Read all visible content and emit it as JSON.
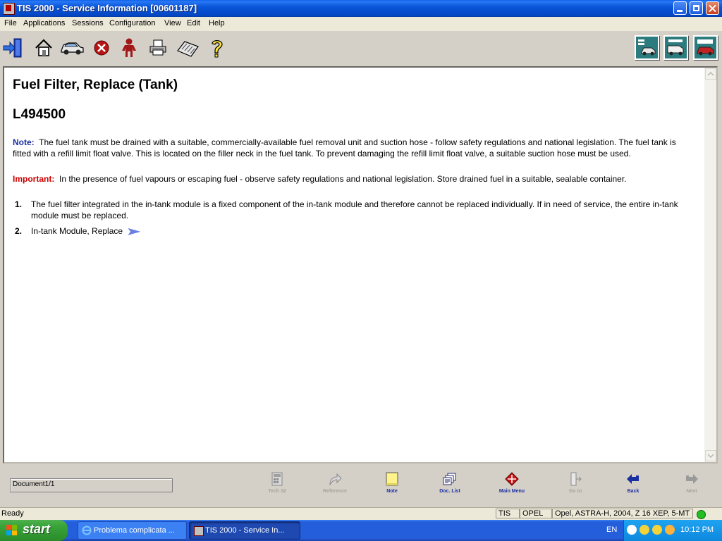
{
  "window": {
    "title": "TIS 2000 - Service Information [00601187]",
    "menus": [
      "File",
      "Applications",
      "Sessions",
      "Configuration",
      "View",
      "Edit",
      "Help"
    ]
  },
  "toolbar": {
    "icons": [
      "exit-icon",
      "home-icon",
      "vehicle-icon",
      "stop-icon",
      "user-icon",
      "print-icon",
      "keyboard-icon",
      "help-icon"
    ],
    "right_icons": [
      "vehicle-info-icon",
      "service-van-icon",
      "vehicle-catalog-icon"
    ]
  },
  "document": {
    "title": "Fuel Filter, Replace (Tank)",
    "code": "L494500",
    "note_label": "Note:",
    "note_text": "The fuel tank must be drained with a suitable, commercially-available fuel removal unit and suction hose - follow safety regulations and national legislation. The fuel tank is fitted with a refill limit float valve. This is located on the filler neck in the fuel tank. To prevent damaging the refill limit float valve, a suitable suction hose must be used.",
    "important_label": "Important:",
    "important_text": "In the presence of fuel vapours or escaping fuel - observe safety regulations and national legislation. Store drained fuel in a suitable, sealable container.",
    "steps": [
      {
        "num": "1.",
        "text": "The fuel filter integrated in the in-tank module is a fixed component of the in-tank module and therefore cannot be replaced individually. If in need of service, the entire in-tank module must be replaced."
      },
      {
        "num": "2.",
        "text": "In-tank Module, Replace"
      }
    ]
  },
  "navbar": {
    "doc_counter": "Document1/1",
    "buttons": [
      {
        "label": "Tech 32",
        "enabled": false,
        "icon": "calculator-icon"
      },
      {
        "label": "Reference",
        "enabled": false,
        "icon": "reference-arrow-icon"
      },
      {
        "label": "Note",
        "enabled": true,
        "icon": "note-icon"
      },
      {
        "label": "Doc. List",
        "enabled": true,
        "icon": "doc-list-icon"
      },
      {
        "label": "Main Menu",
        "enabled": true,
        "icon": "main-menu-icon"
      },
      {
        "label": "Go to",
        "enabled": false,
        "icon": "goto-icon"
      },
      {
        "label": "Back",
        "enabled": true,
        "icon": "back-arrow-icon"
      },
      {
        "label": "Next",
        "enabled": false,
        "icon": "next-arrow-icon"
      }
    ]
  },
  "statusbar": {
    "status": "Ready",
    "app": "TIS",
    "make": "OPEL",
    "vehicle": "Opel, ASTRA-H, 2004, Z 16 XEP, 5-MT",
    "indicator_color": "#22c022"
  },
  "taskbar": {
    "start_label": "start",
    "tasks": [
      {
        "label": "Problema complicata ...",
        "active": false
      },
      {
        "label": "TIS 2000 - Service In...",
        "active": true
      }
    ],
    "language": "EN",
    "clock": "10:12 PM"
  },
  "colors": {
    "note": "#1a2fa0",
    "important": "#cc0000",
    "titlebar": "#0a55d8"
  }
}
